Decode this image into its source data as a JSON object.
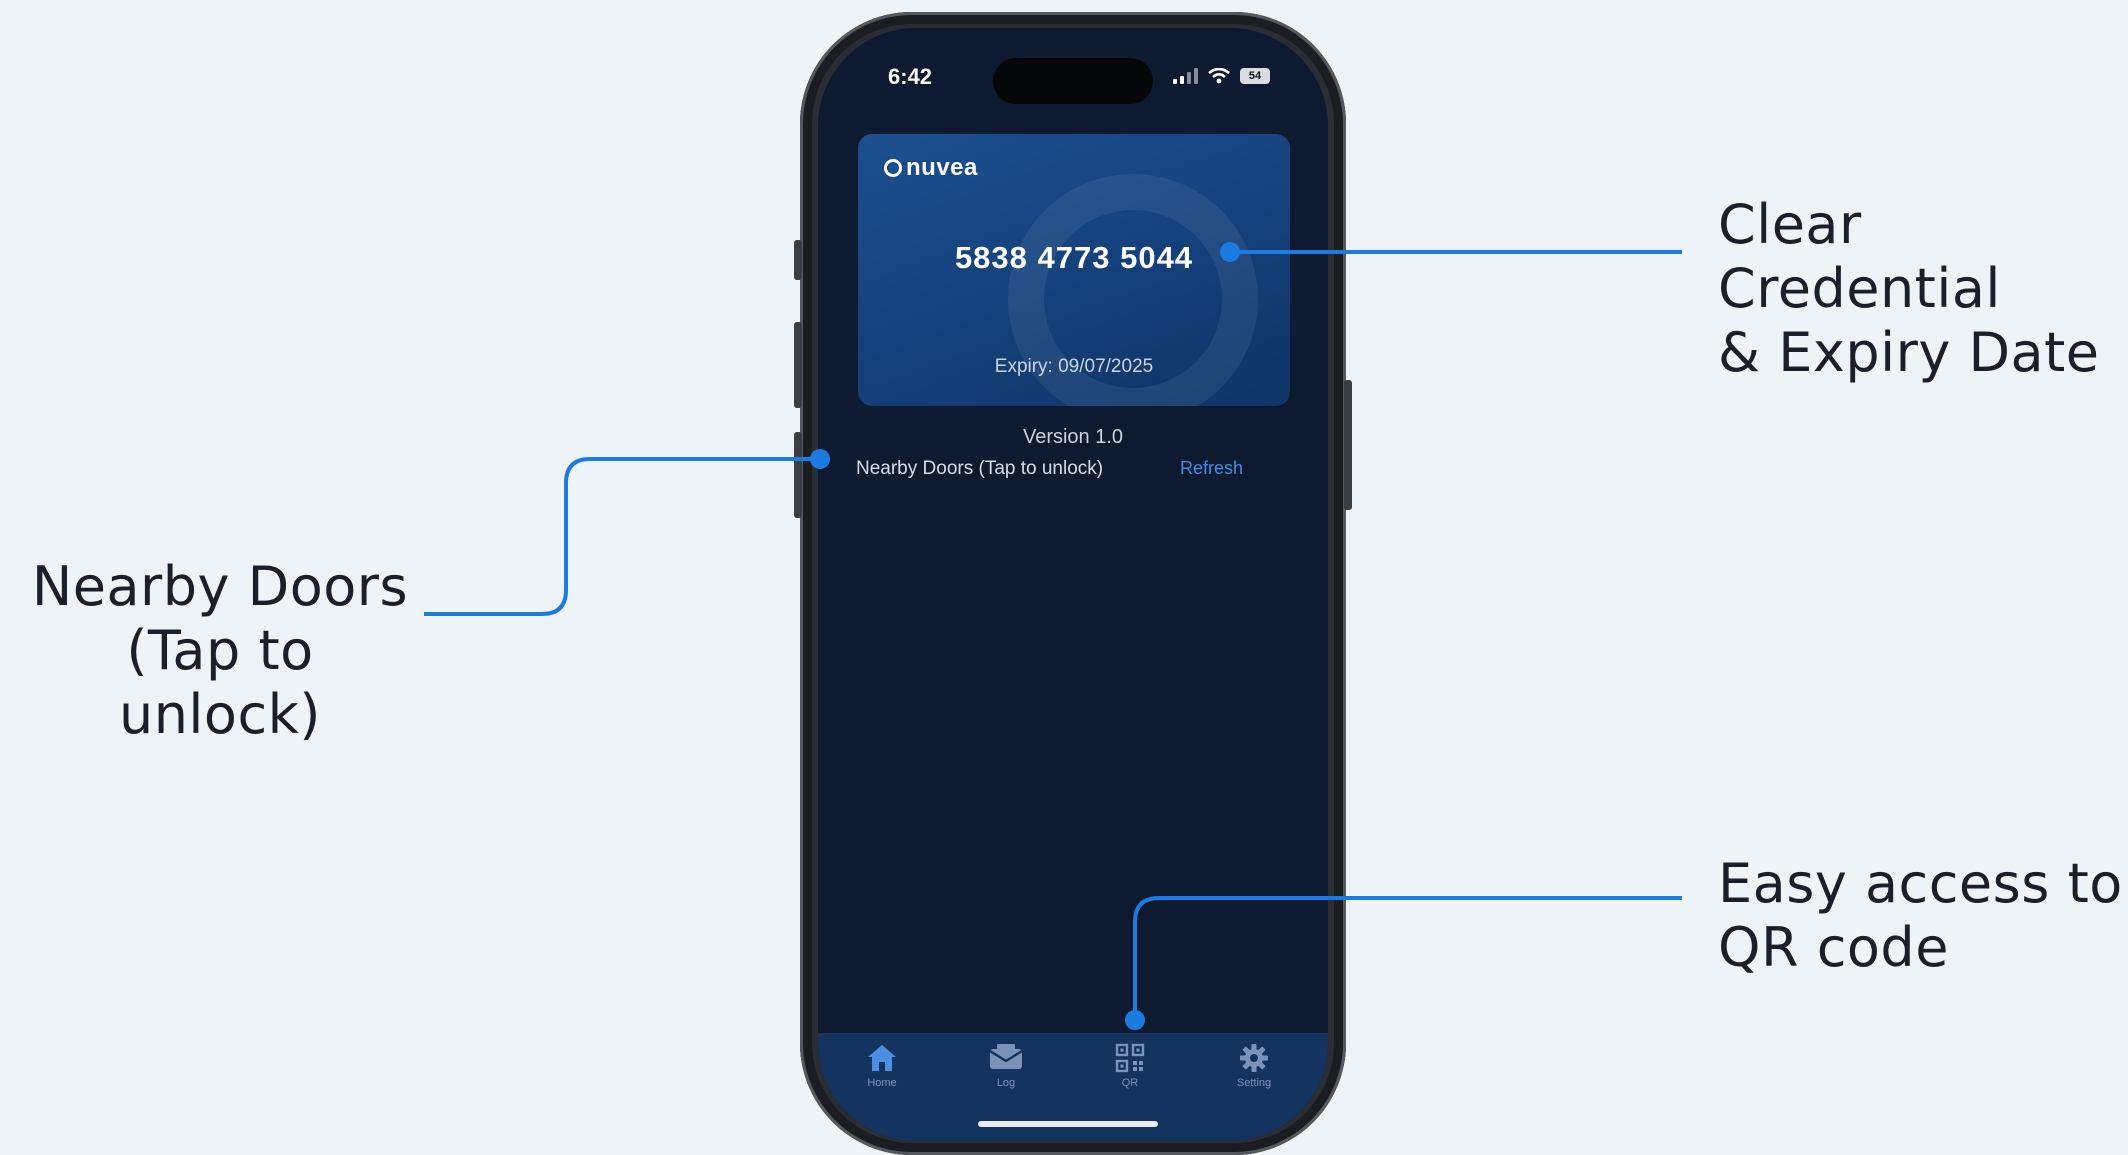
{
  "callouts": {
    "credential": [
      "Clear Credential",
      "& Expiry Date"
    ],
    "doors": [
      "Nearby Doors",
      "(Tap to unlock)"
    ],
    "qr": [
      "Easy access to",
      "QR code"
    ]
  },
  "status_bar": {
    "time": "6:42",
    "battery": "54",
    "icons": [
      "signal-icon",
      "wifi-icon",
      "battery-icon"
    ]
  },
  "card": {
    "logo_text": "nuvea",
    "number": "5838 4773 5044",
    "expiry": "Expiry: 09/07/2025"
  },
  "version": "Version 1.0",
  "nearby": {
    "label": "Nearby Doors (Tap to unlock)",
    "refresh": "Refresh"
  },
  "tabs": [
    {
      "label": "Home",
      "icon": "home-icon"
    },
    {
      "label": "Log",
      "icon": "log-icon"
    },
    {
      "label": "QR",
      "icon": "qr-icon"
    },
    {
      "label": "Setting",
      "icon": "gear-icon"
    }
  ],
  "colors": {
    "accent": "#1b7be0",
    "background": "#eef3f8",
    "screen": "#0e1a2f",
    "card": "#14407a"
  }
}
